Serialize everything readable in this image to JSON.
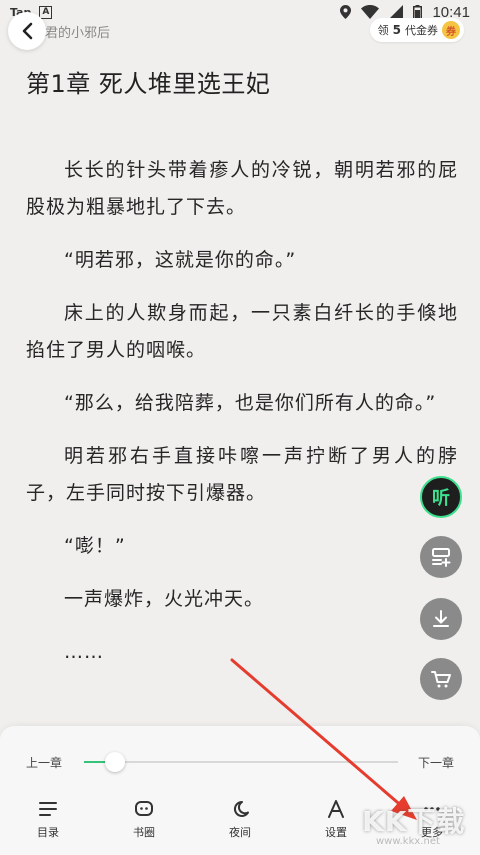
{
  "status_bar": {
    "left_app": "Tap",
    "left_badge": "A",
    "time": "10:41"
  },
  "header": {
    "book_title": "病君的小邪后",
    "coupon": {
      "prefix": "领",
      "count": "5",
      "suffix": "代金券",
      "icon_char": "券"
    }
  },
  "chapter": {
    "title": "第1章 死人堆里选王妃",
    "paragraphs": [
      "长长的针头带着瘆人的冷锐，朝明若邪的屁股极为粗暴地扎了下去。",
      "“明若邪，这就是你的命。”",
      "床上的人欺身而起，一只素白纤长的手倏地掐住了男人的咽喉。",
      "“那么，给我陪葬，也是你们所有人的命。”",
      "明若邪右手直接咔嚓一声拧断了男人的脖子，左手同时按下引爆器。",
      "“嘭！”",
      "一声爆炸，火光冲天。",
      "……"
    ]
  },
  "side_buttons": {
    "listen_label": "听"
  },
  "bottom_panel": {
    "prev_chapter": "上一章",
    "next_chapter": "下一章",
    "progress_fraction": 0.1,
    "tools": [
      {
        "label": "目录",
        "icon": "menu-icon"
      },
      {
        "label": "书圈",
        "icon": "chat-bubble-icon"
      },
      {
        "label": "夜间",
        "icon": "moon-icon"
      },
      {
        "label": "设置",
        "icon": "font-a-icon"
      },
      {
        "label": "更多",
        "icon": "more-dots-icon"
      }
    ]
  },
  "watermark": {
    "text": "KK下载",
    "url": "www.kkx.net"
  },
  "colors": {
    "background": "#f0efed",
    "accent_green": "#33c47a",
    "arrow_red": "#e53c2e"
  }
}
